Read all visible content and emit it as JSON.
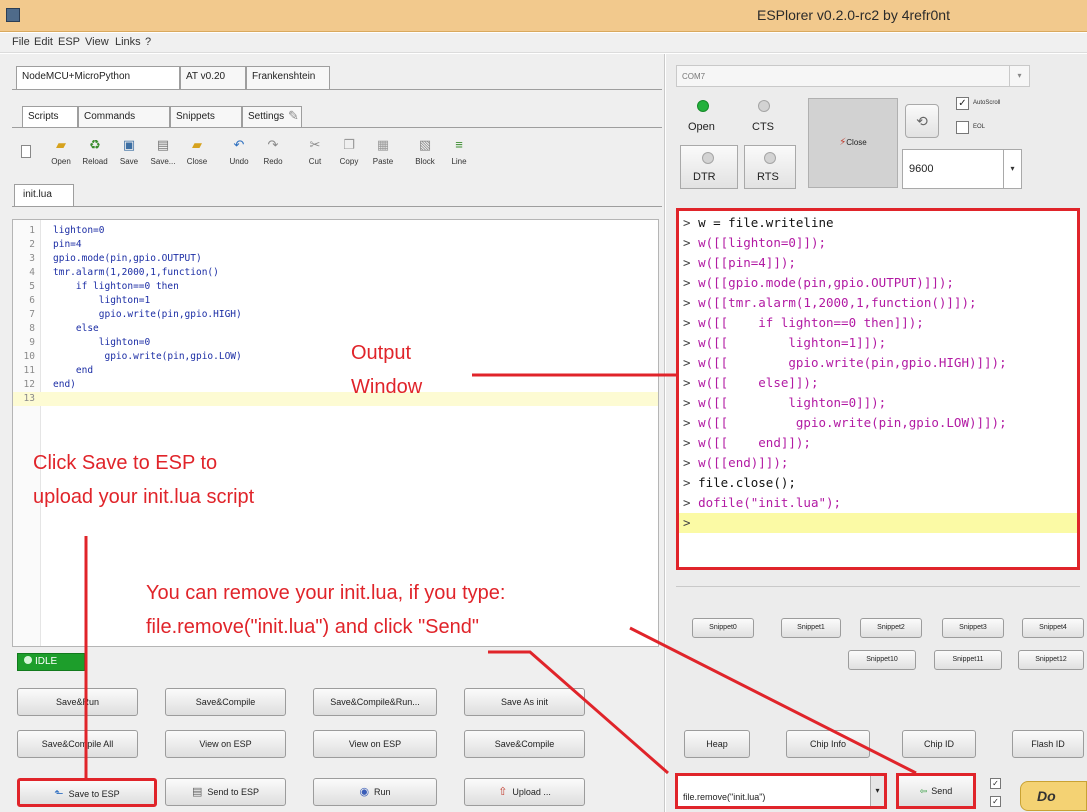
{
  "window": {
    "title": "ESPlorer v0.2.0-rc2 by 4refr0nt"
  },
  "menu": [
    "File",
    "Edit",
    "ESP",
    "View",
    "Links",
    "?"
  ],
  "left": {
    "top_tabs": [
      "NodeMCU+MicroPython",
      "AT v0.20",
      "Frankenshtein"
    ],
    "sub_tabs": [
      "Scripts",
      "Commands",
      "Snippets",
      "Settings"
    ],
    "toolbar": [
      "Open",
      "Reload",
      "Save",
      "Save...",
      "Close",
      "Undo",
      "Redo",
      "Cut",
      "Copy",
      "Paste",
      "Block",
      "Line"
    ],
    "file_tab": "init.lua",
    "code_lines": [
      {
        "n": "1",
        "t": "lighton=0"
      },
      {
        "n": "2",
        "t": "pin=4"
      },
      {
        "n": "3",
        "t": "gpio.mode(pin,gpio.OUTPUT)"
      },
      {
        "n": "4",
        "t": "tmr.alarm(1,2000,1,function()"
      },
      {
        "n": "5",
        "t": "    if lighton==0 then"
      },
      {
        "n": "6",
        "t": "        lighton=1"
      },
      {
        "n": "7",
        "t": "        gpio.write(pin,gpio.HIGH)"
      },
      {
        "n": "8",
        "t": "    else"
      },
      {
        "n": "9",
        "t": "        lighton=0"
      },
      {
        "n": "10",
        "t": "         gpio.write(pin,gpio.LOW)"
      },
      {
        "n": "11",
        "t": "    end"
      },
      {
        "n": "12",
        "t": "end)"
      },
      {
        "n": "13",
        "t": ""
      }
    ],
    "status": "IDLE",
    "buttons_row1": [
      "Save&Run",
      "Save&Compile",
      "Save&Compile&Run...",
      "Save As init"
    ],
    "buttons_row2": [
      "Save&Compile All",
      "View on ESP",
      "View on ESP",
      "Save&Compile"
    ],
    "buttons_row3": [
      "Save to ESP",
      "Send to ESP",
      "Run",
      "Upload ..."
    ]
  },
  "right": {
    "port": "COM7",
    "open_label": "Open",
    "cts_label": "CTS",
    "dtr_label": "DTR",
    "rts_label": "RTS",
    "close_label": "Close",
    "autoscroll_label": "AutoScroll",
    "eol_label": "EOL",
    "baud": "9600",
    "output_lines": [
      {
        "p": ">",
        "t": "w = file.writeline",
        "c": "od"
      },
      {
        "p": ">",
        "t": "w([[lighton=0]]);",
        "c": "oc"
      },
      {
        "p": ">",
        "t": "w([[pin=4]]);",
        "c": "oc"
      },
      {
        "p": ">",
        "t": "w([[gpio.mode(pin,gpio.OUTPUT)]]);",
        "c": "oc"
      },
      {
        "p": ">",
        "t": "w([[tmr.alarm(1,2000,1,function()]]);",
        "c": "oc"
      },
      {
        "p": ">",
        "t": "w([[    if lighton==0 then]]);",
        "c": "oc"
      },
      {
        "p": ">",
        "t": "w([[        lighton=1]]);",
        "c": "oc"
      },
      {
        "p": ">",
        "t": "w([[        gpio.write(pin,gpio.HIGH)]]);",
        "c": "oc"
      },
      {
        "p": ">",
        "t": "w([[    else]]);",
        "c": "oc"
      },
      {
        "p": ">",
        "t": "w([[        lighton=0]]);",
        "c": "oc"
      },
      {
        "p": ">",
        "t": "w([[         gpio.write(pin,gpio.LOW)]]);",
        "c": "oc"
      },
      {
        "p": ">",
        "t": "w([[    end]]);",
        "c": "oc"
      },
      {
        "p": ">",
        "t": "w([[end)]]);",
        "c": "oc"
      },
      {
        "p": ">",
        "t": "file.close();",
        "c": "od"
      },
      {
        "p": ">",
        "t": "dofile(\"init.lua\");",
        "c": "oc"
      },
      {
        "p": ">",
        "t": "",
        "c": "od"
      }
    ],
    "snippets_row1": [
      "Snippet0",
      "Snippet1",
      "Snippet2",
      "Snippet3",
      "Snippet4"
    ],
    "snippets_row2": [
      "Snippet10",
      "Snippet11",
      "Snippet12"
    ],
    "bottom_buttons": [
      "Heap",
      "Chip Info",
      "Chip ID",
      "Flash ID"
    ],
    "command_value": "file.remove(\"init.lua\")",
    "send_label": "Send",
    "do_label": "Do"
  },
  "annotations": {
    "output_window": [
      "Output",
      "Window"
    ],
    "save_hint": [
      "Click Save to ESP to",
      "upload your init.lua script"
    ],
    "remove_hint": [
      "You can remove your init.lua, if you type:",
      "file.remove(\"init.lua\") and click \"Send\""
    ]
  },
  "colors": {
    "annotation_red": "#e0242a",
    "title_bar": "#f2c98d",
    "idle_green": "#1d9e2b",
    "do_button": "#f4d273"
  }
}
